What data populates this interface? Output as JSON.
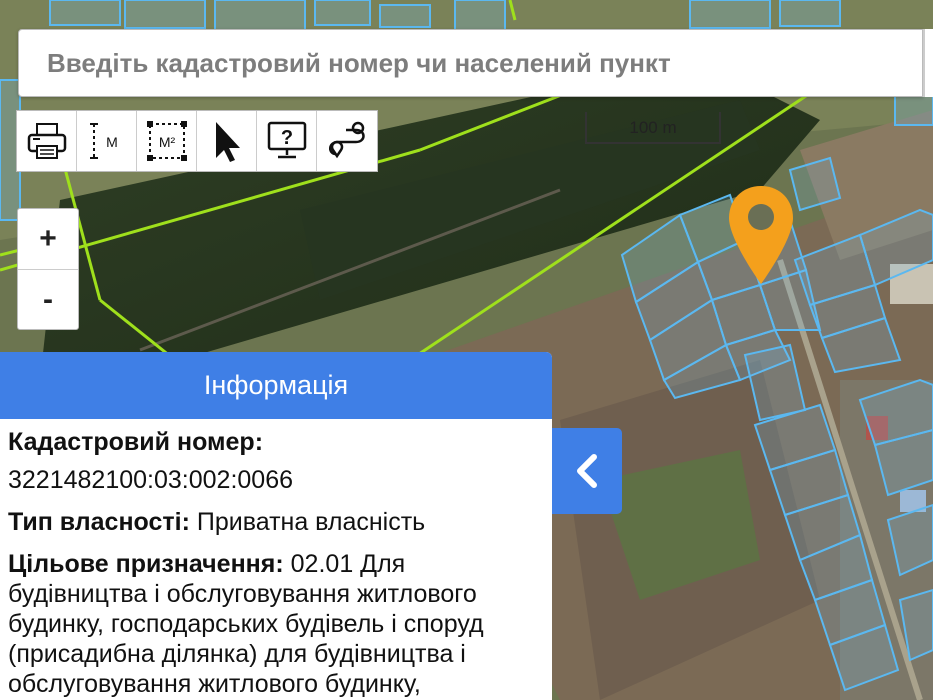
{
  "search": {
    "placeholder": "Введіть кадастровий номер чи населений пункт"
  },
  "toolbar": {
    "tools": [
      {
        "icon": "printer-icon"
      },
      {
        "icon": "measure-distance-icon",
        "label": "М"
      },
      {
        "icon": "measure-area-icon",
        "label": "М²"
      },
      {
        "icon": "cursor-arrow-icon"
      },
      {
        "icon": "help-monitor-icon"
      },
      {
        "icon": "route-icon"
      }
    ]
  },
  "zoom": {
    "in_label": "+",
    "out_label": "-"
  },
  "scale": {
    "label": "100 m"
  },
  "marker": {
    "icon": "location-pin-icon",
    "color": "#f4a01c"
  },
  "info": {
    "title": "Інформація",
    "cadastral_label": "Кадастровий номер:",
    "cadastral_value": "3221482100:03:002:0066",
    "ownership_label": "Тип власності:",
    "ownership_value": "Приватна власність",
    "purpose_label": "Цільове призначення:",
    "purpose_value": "02.01 Для будівництва і обслуговування житлового будинку, господарських будівель і споруд (присадибна ділянка) для будівництва і обслуговування житлового будинку,"
  },
  "collapse": {
    "icon": "chevron-left-icon"
  },
  "colors": {
    "accent": "#3f7fe6",
    "parcel": "#5bb8f0",
    "boundary": "#9fe01c"
  }
}
